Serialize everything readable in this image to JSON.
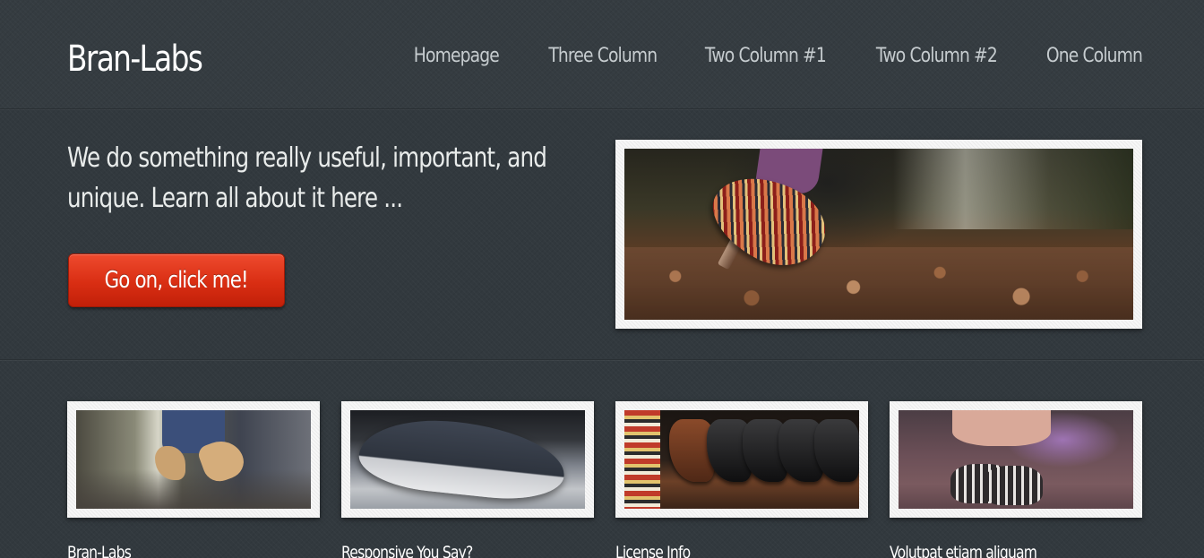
{
  "site": {
    "logo": "Bran-Labs"
  },
  "nav": {
    "items": [
      {
        "label": "Homepage"
      },
      {
        "label": "Three Column"
      },
      {
        "label": "Two Column #1"
      },
      {
        "label": "Two Column #2"
      },
      {
        "label": "One Column"
      }
    ]
  },
  "hero": {
    "headline": "We do something really useful, important, and unique. Learn all about it here ...",
    "cta_label": "Go on, click me!",
    "image_subject": "shoe-on-rail-photo"
  },
  "features": [
    {
      "title": "Bran-Labs",
      "image_subject": "high-heels-photo"
    },
    {
      "title": "Responsive You Say?",
      "image_subject": "sneaker-photo"
    },
    {
      "title": "License Info",
      "image_subject": "boots-shelf-photo"
    },
    {
      "title": "Volutpat etiam aliquam",
      "image_subject": "canvas-shoes-photo"
    }
  ],
  "colors": {
    "background": "#32393e",
    "accent_button": "#d92e13",
    "text": "#e9ecec",
    "nav_text": "#c6cccf",
    "frame": "#f4f4f4"
  }
}
